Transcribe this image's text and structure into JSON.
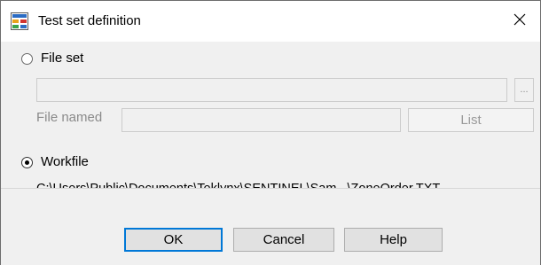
{
  "window": {
    "title": "Test set definition",
    "close_glyph": "✕",
    "icon": "test-set-app-icon"
  },
  "file_set": {
    "label": "File set",
    "selected": false,
    "path_value": "",
    "browse_label": "...",
    "file_named_label": "File named",
    "file_named_value": "",
    "list_label": "List"
  },
  "workfile": {
    "label": "Workfile",
    "selected": true,
    "path": "C:\\Users\\Public\\Documents\\Teklynx\\SENTINEL\\Sam...\\ZoneOrder.TXT"
  },
  "buttons": {
    "ok": "OK",
    "cancel": "Cancel",
    "help": "Help"
  },
  "colors": {
    "focus_border": "#0078d7",
    "dialog_background": "#f0f0f0",
    "disabled_text": "#8a8a8a"
  }
}
